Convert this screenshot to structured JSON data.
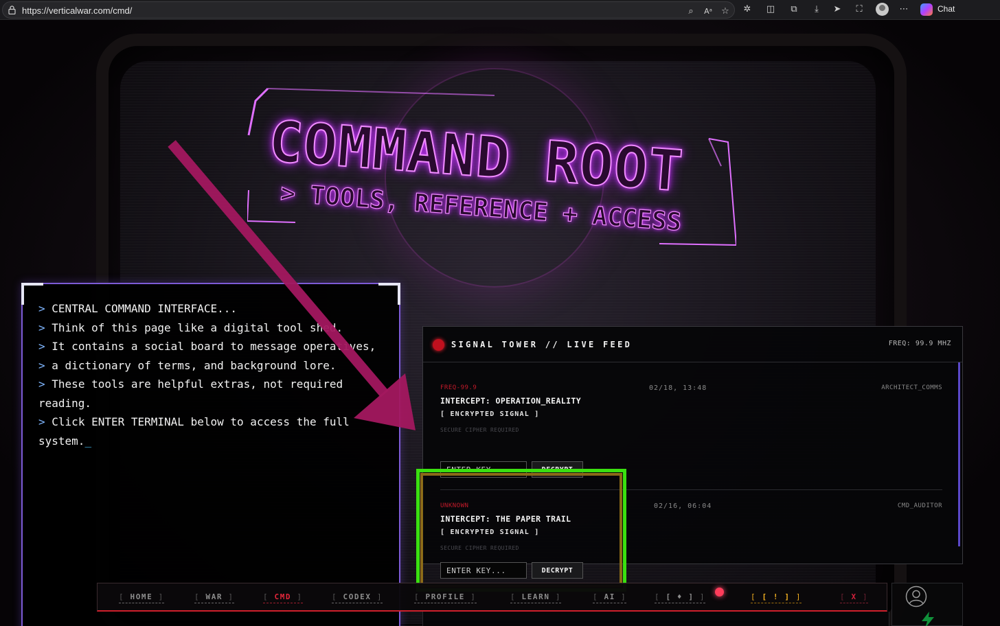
{
  "browser": {
    "url": "https://verticalwar.com/cmd/",
    "chat_label": "Chat"
  },
  "hero": {
    "title": "COMMAND ROOT",
    "subtitle": "> TOOLS, REFERENCE + ACCESS"
  },
  "terminal": {
    "prompt": ">",
    "lines": [
      {
        "text": "CENTRAL COMMAND INTERFACE..."
      },
      {
        "text": "Think of this page like a digital tool shed."
      },
      {
        "text": "It contains a social board to message operatives,"
      },
      {
        "text": "a dictionary of terms, and background lore."
      },
      {
        "text": "These tools are helpful extras, not required reading."
      },
      {
        "text": "Click ENTER TERMINAL below to access the full system."
      }
    ],
    "cursor": "_"
  },
  "signal_tower": {
    "title": "SIGNAL TOWER // LIVE FEED",
    "freq": "FREQ: 99.9 MHZ",
    "messages": [
      {
        "source": "FREQ-99.9",
        "date": "02/18, 13:48",
        "author": "ARCHITECT_COMMS",
        "title": "INTERCEPT: OPERATION_REALITY",
        "status": "[ ENCRYPTED SIGNAL ]",
        "note": "SECURE CIPHER REQUIRED",
        "placeholder": "ENTER KEY...",
        "button": "DECRYPT"
      },
      {
        "source": "UNKNOWN",
        "date": "02/16, 06:04",
        "author": "CMD_AUDITOR",
        "title": "INTERCEPT: THE PAPER TRAIL",
        "status": "[ ENCRYPTED SIGNAL ]",
        "note": "SECURE CIPHER REQUIRED",
        "placeholder": "ENTER KEY...",
        "button": "DECRYPT"
      }
    ]
  },
  "nav": {
    "items": [
      {
        "label": "HOME"
      },
      {
        "label": "WAR"
      },
      {
        "label": "CMD",
        "active": true
      },
      {
        "label": "CODEX"
      },
      {
        "label": "PROFILE"
      },
      {
        "label": "LEARN"
      },
      {
        "label": "AI"
      },
      {
        "label": "[ ♦ ]"
      },
      {
        "label": "[ ! ]"
      },
      {
        "label": "X"
      }
    ]
  },
  "colors": {
    "accent_neon": "#f08cff",
    "nav_active": "#e3263a",
    "highlight_green": "#3ae010",
    "annotation_arrow": "#a3185f",
    "terminal_border": "#7d5bd6"
  },
  "icons": {
    "annotation": "arrow-annotation-icon",
    "user": "user-circle-icon",
    "bolt": "bolt-icon"
  }
}
